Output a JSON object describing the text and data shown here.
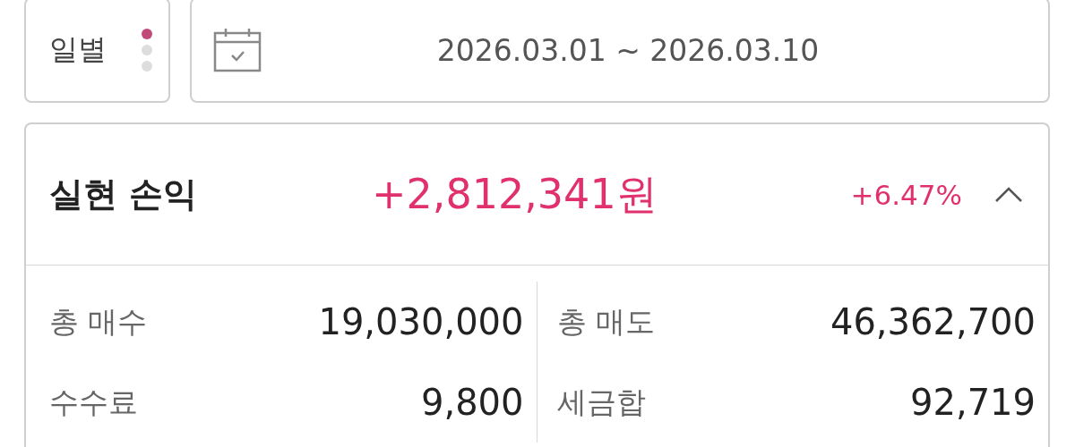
{
  "period": {
    "label": "일별",
    "indicator": [
      {
        "selected": true
      },
      {
        "selected": false
      },
      {
        "selected": false
      }
    ]
  },
  "date_range": {
    "value": "2026.03.01 ~ 2026.03.10"
  },
  "summary": {
    "title": "실현 손익",
    "amount": "+2,812,341원",
    "rate": "+6.47%",
    "expanded": true,
    "items": [
      {
        "label": "총 매수",
        "value": "19,030,000"
      },
      {
        "label": "총 매도",
        "value": "46,362,700"
      },
      {
        "label": "수수료",
        "value": "9,800"
      },
      {
        "label": "세금합",
        "value": "92,719"
      }
    ]
  }
}
